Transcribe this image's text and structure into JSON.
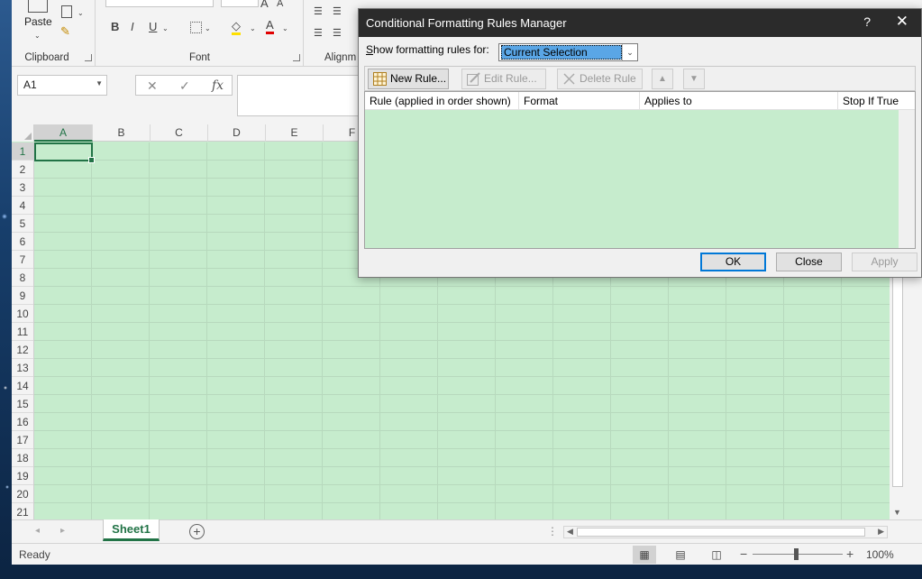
{
  "ribbon": {
    "clipboard_label": "Clipboard",
    "paste_label": "Paste",
    "font_label": "Font",
    "alignment_label": "Alignm"
  },
  "formula_bar": {
    "name_box": "A1",
    "cancel_icon": "✕",
    "enter_icon": "✓",
    "fx_label": "fx"
  },
  "grid": {
    "columns": [
      "A",
      "B",
      "C",
      "D",
      "E",
      "F"
    ],
    "rows": [
      "1",
      "2",
      "3",
      "4",
      "5",
      "6",
      "7",
      "8",
      "9",
      "10",
      "11",
      "12",
      "13",
      "14",
      "15",
      "16",
      "17",
      "18",
      "19",
      "20",
      "21"
    ],
    "selected_cell": "A1",
    "fill_color": "#c6eccd"
  },
  "sheet_tabs": {
    "active": "Sheet1",
    "add_icon": "+"
  },
  "status": {
    "text": "Ready",
    "zoom_minus": "−",
    "zoom_plus": "+",
    "zoom": "100%"
  },
  "dialog": {
    "title": "Conditional Formatting Rules Manager",
    "help": "?",
    "close": "✕",
    "show_rules_label": "Show formatting rules for:",
    "show_rules_value": "Current Selection",
    "new_rule": "New Rule...",
    "edit_rule": "Edit Rule...",
    "delete_rule": "Delete Rule",
    "move_up": "▲",
    "move_down": "▼",
    "columns": [
      "Rule (applied in order shown)",
      "Format",
      "Applies to",
      "Stop If True"
    ],
    "ok": "OK",
    "close_button": "Close",
    "apply": "Apply"
  },
  "colors": {
    "accent": "#217346",
    "highlight": "#5aa6e6",
    "focus": "#0078d7"
  }
}
